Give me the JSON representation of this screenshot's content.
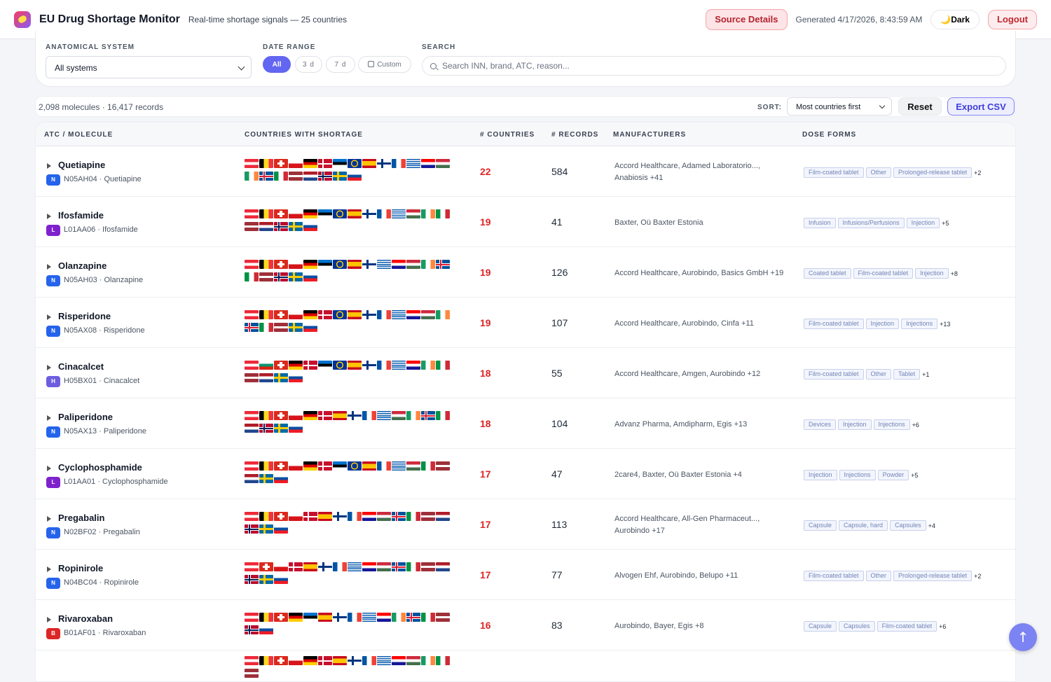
{
  "header": {
    "title": "EU Drug Shortage Monitor",
    "subtitle": "Real-time shortage signals — 25 countries",
    "source_btn": "Source Details",
    "generated": "Generated 4/17/2026, 8:43:59 AM",
    "dark_btn": "🌙Dark",
    "logout_btn": "Logout"
  },
  "filters": {
    "system_label": "ANATOMICAL SYSTEM",
    "system_value": "All systems",
    "range_label": "DATE RANGE",
    "range_all": "All",
    "range_3d": "3 d",
    "range_7d": "7 d",
    "range_custom": "Custom",
    "search_label": "SEARCH",
    "search_placeholder": "Search INN, brand, ATC, reason..."
  },
  "summary": {
    "stats": "2,098 molecules · 16,417 records",
    "sort_label": "SORT:",
    "sort_value": "Most countries first",
    "reset": "Reset",
    "export": "Export CSV"
  },
  "table": {
    "columns": [
      "ATC / MOLECULE",
      "COUNTRIES WITH SHORTAGE",
      "# COUNTRIES",
      "# RECORDS",
      "MANUFACTURERS",
      "DOSE FORMS"
    ],
    "rows": [
      {
        "name": "Quetiapine",
        "letter": "N",
        "atc": "N05AH04 · Quetiapine",
        "countries": "22",
        "records": "584",
        "manufacturers": "Accord Healthcare, Adamed Laboratorio..., Anabiosis +41",
        "forms": [
          "Film-coated tablet",
          "Other",
          "Prolonged-release tablet"
        ],
        "more": "+2",
        "flags": [
          "at",
          "be",
          "ch",
          "cz",
          "de",
          "dk",
          "ee",
          "eu",
          "es",
          "fi",
          "fr",
          "gr",
          "hr",
          "hu",
          "ie",
          "is",
          "it",
          "lv",
          "nl",
          "no",
          "se",
          "sk"
        ]
      },
      {
        "name": "Ifosfamide",
        "letter": "L",
        "atc": "L01AA06 · Ifosfamide",
        "countries": "19",
        "records": "41",
        "manufacturers": "Baxter, Oü Baxter Estonia",
        "forms": [
          "Infusion",
          "Infusions/Perfusions",
          "Injection"
        ],
        "more": "+5",
        "flags": [
          "at",
          "be",
          "ch",
          "cz",
          "de",
          "ee",
          "eu",
          "es",
          "fi",
          "fr",
          "gr",
          "hu",
          "ie",
          "it",
          "lv",
          "nl",
          "no",
          "se",
          "sk"
        ]
      },
      {
        "name": "Olanzapine",
        "letter": "N",
        "atc": "N05AH03 · Olanzapine",
        "countries": "19",
        "records": "126",
        "manufacturers": "Accord Healthcare, Aurobindo, Basics GmbH +19",
        "forms": [
          "Coated tablet",
          "Film-coated tablet",
          "Injection"
        ],
        "more": "+8",
        "flags": [
          "at",
          "be",
          "ch",
          "cz",
          "de",
          "ee",
          "eu",
          "es",
          "fi",
          "gr",
          "hr",
          "hu",
          "ie",
          "is",
          "it",
          "lv",
          "no",
          "se",
          "sk"
        ]
      },
      {
        "name": "Risperidone",
        "letter": "N",
        "atc": "N05AX08 · Risperidone",
        "countries": "19",
        "records": "107",
        "manufacturers": "Accord Healthcare, Aurobindo, Cinfa +11",
        "forms": [
          "Film-coated tablet",
          "Injection",
          "Injections"
        ],
        "more": "+13",
        "flags": [
          "at",
          "be",
          "ch",
          "cz",
          "de",
          "dk",
          "eu",
          "es",
          "fi",
          "fr",
          "gr",
          "hr",
          "hu",
          "ie",
          "is",
          "it",
          "lv",
          "se",
          "sk"
        ]
      },
      {
        "name": "Cinacalcet",
        "letter": "H",
        "atc": "H05BX01 · Cinacalcet",
        "countries": "18",
        "records": "55",
        "manufacturers": "Accord Healthcare, Amgen, Aurobindo +12",
        "forms": [
          "Film-coated tablet",
          "Other",
          "Tablet"
        ],
        "more": "+1",
        "flags": [
          "at",
          "bg",
          "ch",
          "de",
          "dk",
          "ee",
          "eu",
          "es",
          "fi",
          "fr",
          "gr",
          "hr",
          "ie",
          "it",
          "lv",
          "nl",
          "se",
          "sk"
        ]
      },
      {
        "name": "Paliperidone",
        "letter": "N",
        "atc": "N05AX13 · Paliperidone",
        "countries": "18",
        "records": "104",
        "manufacturers": "Advanz Pharma, Amdipharm, Egis +13",
        "forms": [
          "Devices",
          "Injection",
          "Injections"
        ],
        "more": "+6",
        "flags": [
          "at",
          "be",
          "ch",
          "cz",
          "de",
          "dk",
          "es",
          "fi",
          "fr",
          "gr",
          "hu",
          "ie",
          "is",
          "it",
          "nl",
          "no",
          "se",
          "sk"
        ]
      },
      {
        "name": "Cyclophosphamide",
        "letter": "L",
        "atc": "L01AA01 · Cyclophosphamide",
        "countries": "17",
        "records": "47",
        "manufacturers": "2care4, Baxter, Oü Baxter Estonia +4",
        "forms": [
          "Injection",
          "Injections",
          "Powder"
        ],
        "more": "+5",
        "flags": [
          "at",
          "be",
          "ch",
          "cz",
          "de",
          "dk",
          "ee",
          "eu",
          "es",
          "fr",
          "gr",
          "hu",
          "it",
          "lv",
          "nl",
          "se",
          "sk"
        ]
      },
      {
        "name": "Pregabalin",
        "letter": "N",
        "atc": "N02BF02 · Pregabalin",
        "countries": "17",
        "records": "113",
        "manufacturers": "Accord Healthcare, All-Gen Pharmaceut..., Aurobindo +17",
        "forms": [
          "Capsule",
          "Capsule, hard",
          "Capsules"
        ],
        "more": "+4",
        "flags": [
          "at",
          "be",
          "ch",
          "cz",
          "dk",
          "es",
          "fi",
          "fr",
          "hr",
          "hu",
          "is",
          "it",
          "lv",
          "nl",
          "no",
          "se",
          "sk"
        ]
      },
      {
        "name": "Ropinirole",
        "letter": "N",
        "atc": "N04BC04 · Ropinirole",
        "countries": "17",
        "records": "77",
        "manufacturers": "Alvogen Ehf, Aurobindo, Belupo +11",
        "forms": [
          "Film-coated tablet",
          "Other",
          "Prolonged-release tablet"
        ],
        "more": "+2",
        "flags": [
          "at",
          "ch",
          "cz",
          "dk",
          "es",
          "fi",
          "fr",
          "gr",
          "hr",
          "hu",
          "is",
          "it",
          "lv",
          "nl",
          "no",
          "se",
          "sk"
        ]
      },
      {
        "name": "Rivaroxaban",
        "letter": "B",
        "atc": "B01AF01 · Rivaroxaban",
        "countries": "16",
        "records": "83",
        "manufacturers": "Aurobindo, Bayer, Egis +8",
        "forms": [
          "Capsule",
          "Capsules",
          "Film-coated tablet"
        ],
        "more": "+6",
        "flags": [
          "at",
          "be",
          "ch",
          "de",
          "ee",
          "es",
          "fi",
          "fr",
          "gr",
          "hr",
          "ie",
          "is",
          "it",
          "lv",
          "no",
          "sk"
        ]
      },
      {
        "name": "",
        "letter": "",
        "atc": "",
        "countries": "",
        "records": "",
        "manufacturers": "",
        "forms": [],
        "more": "",
        "flags": [
          "at",
          "be",
          "ch",
          "cz",
          "de",
          "dk",
          "es",
          "fi",
          "fr",
          "gr",
          "hr",
          "hu",
          "ie",
          "it",
          "lv"
        ]
      }
    ]
  },
  "scroll_top": "↑",
  "colors": {
    "accent": "#6366f1",
    "danger": "#dc2626",
    "letter_N": "#2563eb",
    "letter_L": "#7e22ce",
    "letter_H": "#6d5ddf",
    "letter_B": "#dc2626"
  }
}
